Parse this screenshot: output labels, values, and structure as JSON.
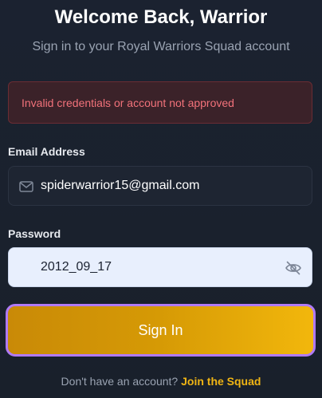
{
  "header": {
    "title": "Welcome Back, Warrior",
    "subtitle": "Sign in to your Royal Warriors Squad account"
  },
  "error": {
    "message": "Invalid credentials or account not approved",
    "color": "#f2727a"
  },
  "form": {
    "email_label": "Email Address",
    "email_value": "spiderwarrior15@gmail.com",
    "email_icon": "mail-icon",
    "password_label": "Password",
    "password_value": "2012_09_17",
    "password_icon": "eye-off-icon",
    "submit_label": "Sign In"
  },
  "footer": {
    "prompt": "Don't have an account?",
    "link_label": "Join the Squad"
  },
  "colors": {
    "accent": "#f0b514",
    "button_gradient_start": "#c98a07",
    "button_gradient_end": "#f2b70c",
    "focus_ring": "#b07af7",
    "background": "#1b2230"
  }
}
